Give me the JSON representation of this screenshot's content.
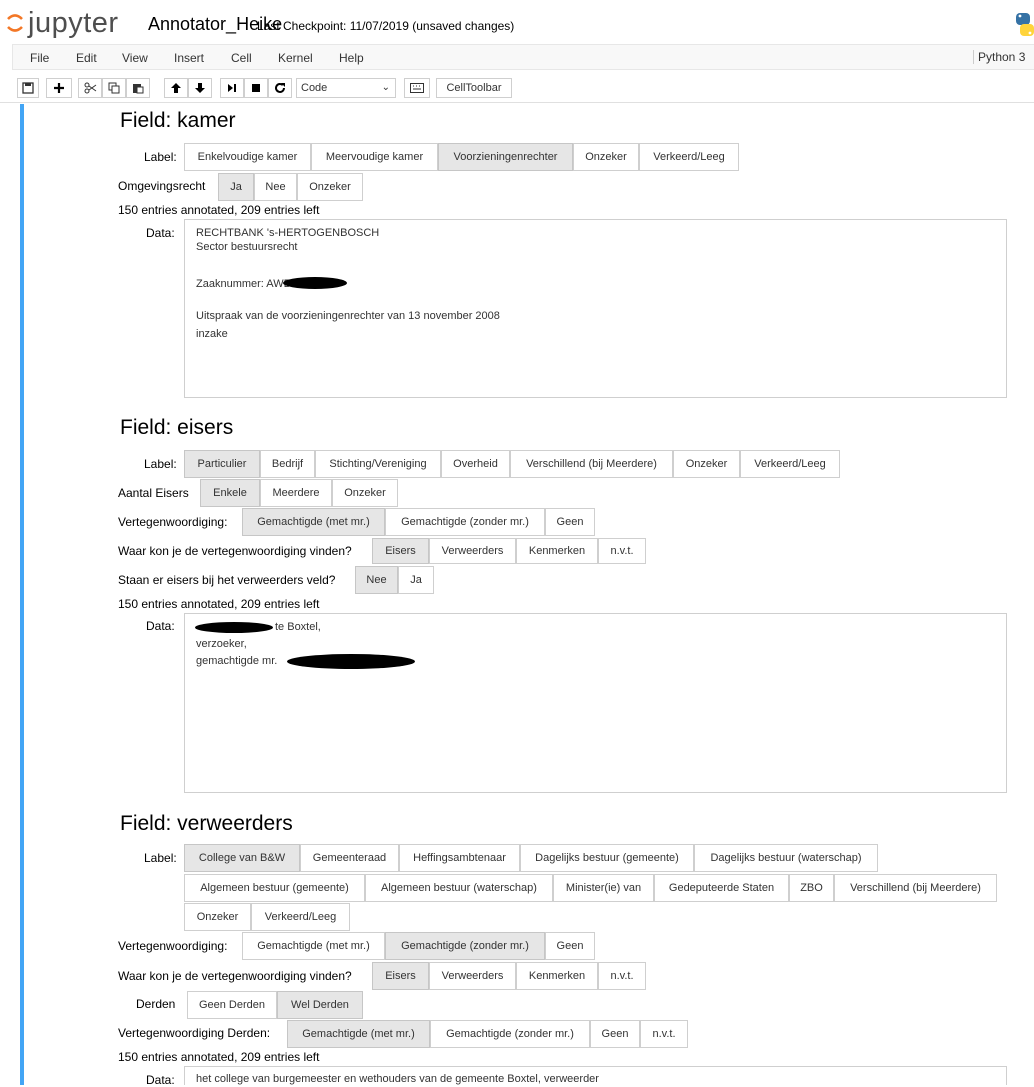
{
  "header": {
    "logo_text": "jupyter",
    "notebook_name": "Annotator_Heike",
    "checkpoint": "Last Checkpoint: 11/07/2019 (unsaved changes)",
    "kernel": "Python 3"
  },
  "menu": [
    "File",
    "Edit",
    "View",
    "Insert",
    "Cell",
    "Kernel",
    "Help"
  ],
  "toolbar": {
    "cell_type": "Code",
    "celltoolbar_label": "CellToolbar"
  },
  "fields": {
    "kamer": {
      "title": "Field: kamer",
      "label_caption": "Label:",
      "labels": [
        "Enkelvoudige kamer",
        "Meervoudige kamer",
        "Voorzieningenrechter",
        "Onzeker",
        "Verkeerd/Leeg"
      ],
      "selected_label": "Voorzieningenrechter",
      "omgevingsrecht_caption": "Omgevingsrecht",
      "omgevingsrecht": [
        "Ja",
        "Nee",
        "Onzeker"
      ],
      "omgevingsrecht_selected": "Ja",
      "progress": "150 entries annotated, 209 entries left",
      "data_caption": "Data:",
      "data_lines": [
        "RECHTBANK 's-HERTOGENBOSCH",
        "Sector bestuursrecht",
        "",
        "Zaaknummer: AWB",
        "",
        "Uitspraak van de voorzieningenrechter van 13 november 2008",
        "inzake"
      ]
    },
    "eisers": {
      "title": "Field: eisers",
      "label_caption": "Label:",
      "labels": [
        "Particulier",
        "Bedrijf",
        "Stichting/Vereniging",
        "Overheid",
        "Verschillend (bij Meerdere)",
        "Onzeker",
        "Verkeerd/Leeg"
      ],
      "selected_label": "Particulier",
      "aantal_caption": "Aantal Eisers",
      "aantal": [
        "Enkele",
        "Meerdere",
        "Onzeker"
      ],
      "aantal_selected": "Enkele",
      "vert_caption": "Vertegenwoordiging:",
      "vert": [
        "Gemachtigde (met mr.)",
        "Gemachtigde (zonder mr.)",
        "Geen"
      ],
      "vert_selected": "Gemachtigde (met mr.)",
      "waar_caption": "Waar kon je de vertegenwoordiging vinden?",
      "waar": [
        "Eisers",
        "Verweerders",
        "Kenmerken",
        "n.v.t."
      ],
      "waar_selected": "Eisers",
      "staan_caption": "Staan er eisers bij het verweerders veld?",
      "staan": [
        "Nee",
        "Ja"
      ],
      "staan_selected": "Nee",
      "progress": "150 entries annotated, 209 entries left",
      "data_caption": "Data:",
      "data_lines": [
        "te Boxtel,",
        "verzoeker,",
        "gemachtigde mr."
      ]
    },
    "verweerders": {
      "title": "Field: verweerders",
      "label_caption": "Label:",
      "labels_row1": [
        "College van B&W",
        "Gemeenteraad",
        "Heffingsambtenaar",
        "Dagelijks bestuur (gemeente)",
        "Dagelijks bestuur (waterschap)"
      ],
      "labels_row2": [
        "Algemeen bestuur (gemeente)",
        "Algemeen bestuur (waterschap)",
        "Minister(ie) van",
        "Gedeputeerde Staten",
        "ZBO",
        "Verschillend (bij Meerdere)"
      ],
      "labels_row3": [
        "Onzeker",
        "Verkeerd/Leeg"
      ],
      "selected_label": "College van B&W",
      "vert_caption": "Vertegenwoordiging:",
      "vert": [
        "Gemachtigde (met mr.)",
        "Gemachtigde (zonder mr.)",
        "Geen"
      ],
      "vert_selected": "Gemachtigde (zonder mr.)",
      "waar_caption": "Waar kon je de vertegenwoordiging vinden?",
      "waar": [
        "Eisers",
        "Verweerders",
        "Kenmerken",
        "n.v.t."
      ],
      "waar_selected": "Eisers",
      "derden_caption": "Derden",
      "derden": [
        "Geen Derden",
        "Wel Derden"
      ],
      "derden_selected": "Wel Derden",
      "vert_derden_caption": "Vertegenwoordiging Derden:",
      "vert_derden": [
        "Gemachtigde (met mr.)",
        "Gemachtigde (zonder mr.)",
        "Geen",
        "n.v.t."
      ],
      "vert_derden_selected": "Gemachtigde (met mr.)",
      "progress": "150 entries annotated, 209 entries left",
      "data_caption": "Data:",
      "data_lines": [
        "het college van burgemeester en wethouders van de gemeente Boxtel, verweerder"
      ]
    }
  },
  "colors": {
    "cell_selected_bar": "#42a5f5",
    "button_selected": "#e6e6e6",
    "logo_orange": "#f37726"
  }
}
